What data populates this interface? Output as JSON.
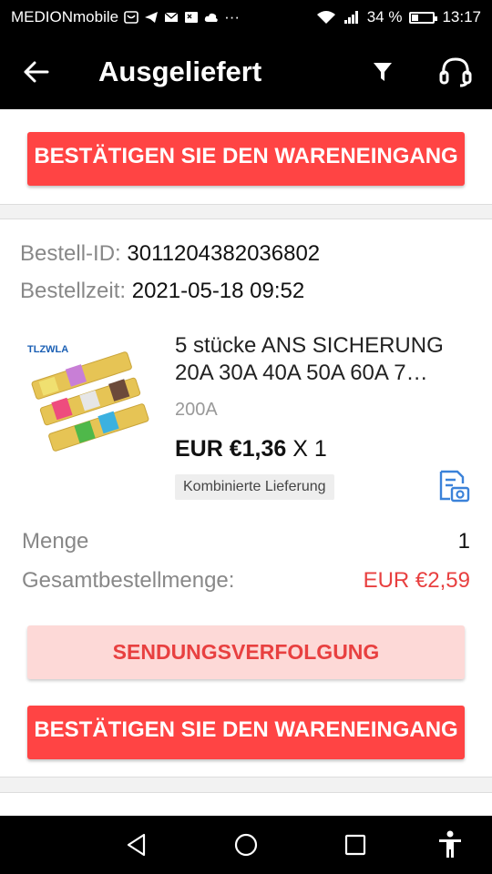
{
  "status_bar": {
    "carrier": "MEDIONmobile",
    "battery_percent": "34 %",
    "battery_level": 0.34,
    "time": "13:17",
    "more": "···"
  },
  "appbar": {
    "title": "Ausgeliefert",
    "icons": [
      "back-arrow-icon",
      "filter-icon",
      "headset-icon"
    ]
  },
  "top_card": {
    "confirm_button": "BESTÄTIGEN SIE DEN WARENEINGANG"
  },
  "order": {
    "id_label": "Bestell-ID:",
    "id_value": "3011204382036802",
    "time_label": "Bestellzeit:",
    "time_value": "2021-05-18 09:52",
    "product": {
      "brand_logo": "TLZWLA",
      "title": "5 stücke ANS SICHERUNG 20A 30A 40A 50A 60A 7…",
      "variant": "200A",
      "price": "EUR €1,36",
      "quantity_suffix": " X 1",
      "tag": "Kombinierte Lieferung"
    },
    "quantity_label": "Menge",
    "quantity_value": "1",
    "total_label": "Gesamtbestellmenge:",
    "total_value": "EUR €2,59",
    "tracking_button": "SENDUNGSVERFOLGUNG",
    "confirm_button": "BESTÄTIGEN SIE DEN WARENEINGANG"
  },
  "colors": {
    "accent": "#FF4747",
    "accent_light": "#FDD9D7",
    "total_red": "#E84040",
    "link_blue": "#3B82D9"
  }
}
